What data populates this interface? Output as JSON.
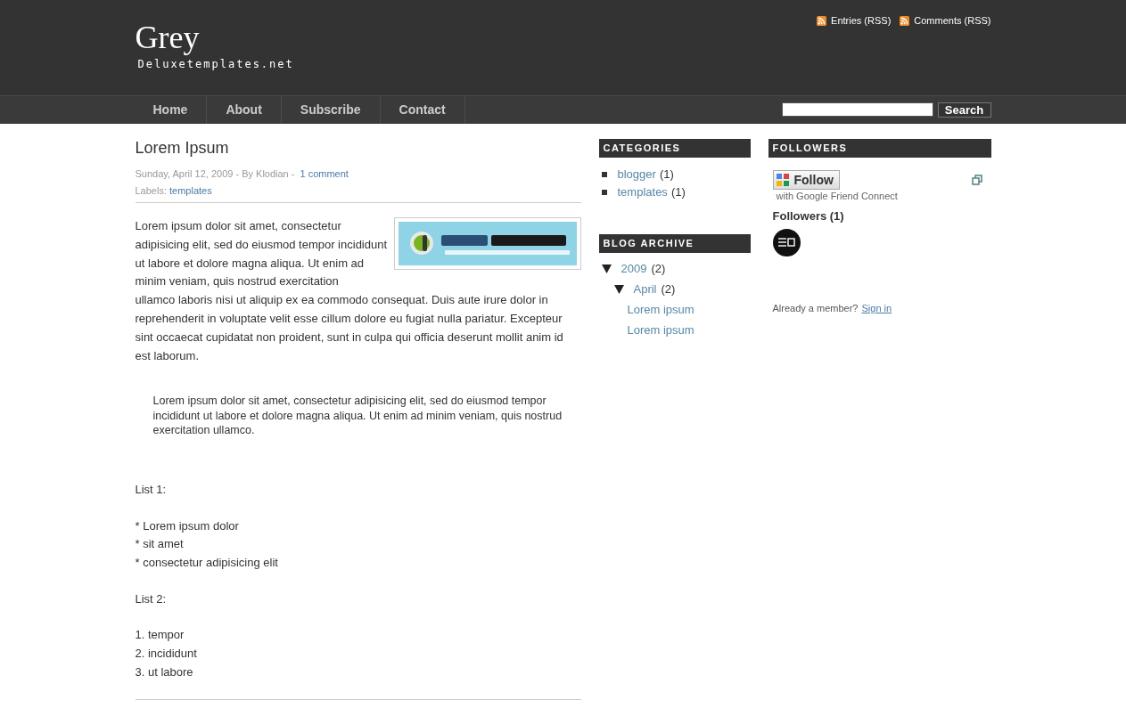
{
  "header": {
    "title": "Grey",
    "tagline": "Deluxetemplates.net",
    "feeds": [
      "Entries (RSS)",
      "Comments (RSS)"
    ]
  },
  "nav": {
    "items": [
      "Home",
      "About",
      "Subscribe",
      "Contact"
    ],
    "search_button": "Search"
  },
  "post": {
    "title": "Lorem Ipsum",
    "meta": "Sunday, April 12, 2009 - By Klodian -",
    "comments": "1 comment",
    "labels_label": "Labels:",
    "labels": [
      "templates"
    ],
    "image": {
      "kind": "picture"
    },
    "blocks": [
      {
        "kind": "para",
        "text": "Lorem ipsum dolor sit amet, consectetur adipisicing elit, sed do eiusmod tempor incididunt ut labore et dolore magna aliqua. Ut enim ad minim veniam, quis nostrud exercitation",
        "text_continued": "ullamco laboris nisi ut aliquip ex ea commodo consequat. Duis aute irure dolor in reprehenderit in voluptate velit esse cillum dolore eu fugiat nulla pariatur. Excepteur sint occaecat cupidatat non proident, sunt in culpa qui officia deserunt mollit anim id est laborum."
      },
      {
        "kind": "quote",
        "text": "Lorem ipsum dolor sit amet, consectetur adipisicing elit, sed do eiusmod tempor incididunt ut labore et dolore magna aliqua. Ut enim ad minim veniam, quis nostrud exercitation ullamco."
      },
      {
        "kind": "lines",
        "lines": [
          "List 1:"
        ]
      },
      {
        "kind": "lines",
        "lines": [
          "* Lorem ipsum dolor",
          "* sit amet",
          "* consectetur adipisicing elit"
        ]
      },
      {
        "kind": "lines",
        "lines": [
          "List 2:"
        ]
      },
      {
        "kind": "lines",
        "lines": [
          "1. tempor",
          "2. incididunt",
          "3. ut labore"
        ]
      }
    ]
  },
  "categories": {
    "title": "CATEGORIES",
    "items": [
      {
        "name": "blogger",
        "count": "(1)"
      },
      {
        "name": "templates",
        "count": "(1)"
      }
    ]
  },
  "archive": {
    "title": "BLOG ARCHIVE",
    "items": [
      {
        "label": "2009",
        "count": "(2)",
        "expanded": true,
        "children": [
          {
            "label": "April",
            "count": "(2)",
            "expanded": true,
            "children": [
              {
                "label": "Lorem ipsum"
              },
              {
                "label": "Lorem ipsum"
              }
            ]
          }
        ]
      }
    ]
  },
  "followers": {
    "title": "FOLLOWERS",
    "follow_button": "Follow",
    "follow_note": "with Google Friend Connect",
    "heading": "Followers (1)",
    "member_text": "Already a member?",
    "sign_in": "Sign in"
  }
}
